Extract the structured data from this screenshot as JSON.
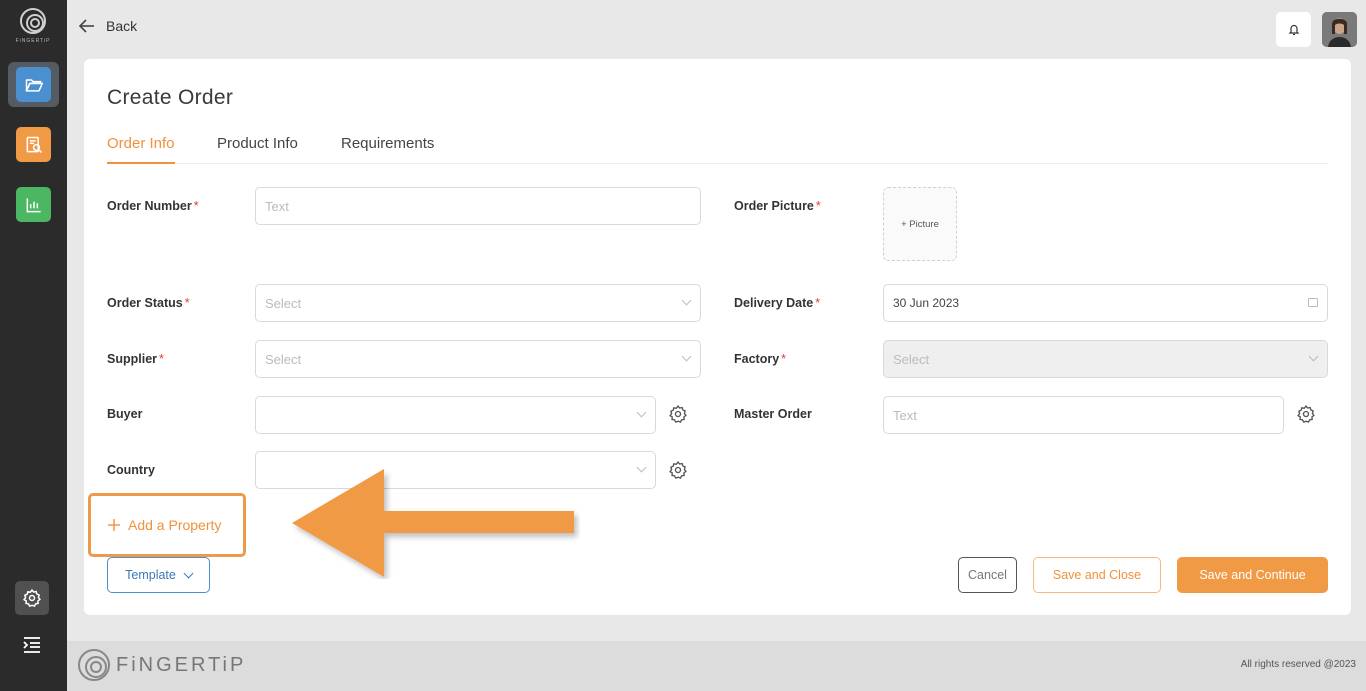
{
  "brand": {
    "sidebar_logo_text": "FiNGERTiP",
    "footer_logo_text": "FiNGERTiP",
    "accent_color": "#f19a45"
  },
  "sidebar": {
    "items": [
      {
        "icon": "folder-open-icon",
        "color": "#4a8fd0",
        "active": true
      },
      {
        "icon": "document-search-icon",
        "color": "#f19a45"
      },
      {
        "icon": "bar-chart-icon",
        "color": "#4cb763"
      }
    ],
    "settings_icon": "gear-icon",
    "menu_icon": "menu-collapse-icon"
  },
  "header": {
    "back_label": "Back",
    "bell_icon": "bell-icon"
  },
  "page": {
    "title": "Create Order",
    "tabs": [
      {
        "label": "Order Info",
        "active": true
      },
      {
        "label": "Product Info"
      },
      {
        "label": "Requirements"
      }
    ]
  },
  "form": {
    "order_number": {
      "label": "Order Number",
      "required_mark": "*",
      "placeholder": "Text"
    },
    "order_picture": {
      "label": "Order Picture",
      "required_mark": "*",
      "button": "+ Picture"
    },
    "order_status": {
      "label": "Order Status",
      "required_mark": "*",
      "placeholder": "Select"
    },
    "delivery_date": {
      "label": "Delivery Date",
      "required_mark": "*",
      "value": "30 Jun 2023"
    },
    "supplier": {
      "label": "Supplier",
      "required_mark": "*",
      "placeholder": "Select"
    },
    "factory": {
      "label": "Factory",
      "required_mark": "*",
      "placeholder": "Select"
    },
    "buyer": {
      "label": "Buyer",
      "value": ""
    },
    "master_order": {
      "label": "Master Order",
      "placeholder": "Text"
    },
    "country": {
      "label": "Country",
      "value": ""
    },
    "add_property": "Add a Property"
  },
  "actions": {
    "template": "Template",
    "cancel": "Cancel",
    "save_and_close": "Save and Close",
    "save_and_continue": "Save and Continue"
  },
  "footer": {
    "copyright": "All rights reserved @2023"
  }
}
